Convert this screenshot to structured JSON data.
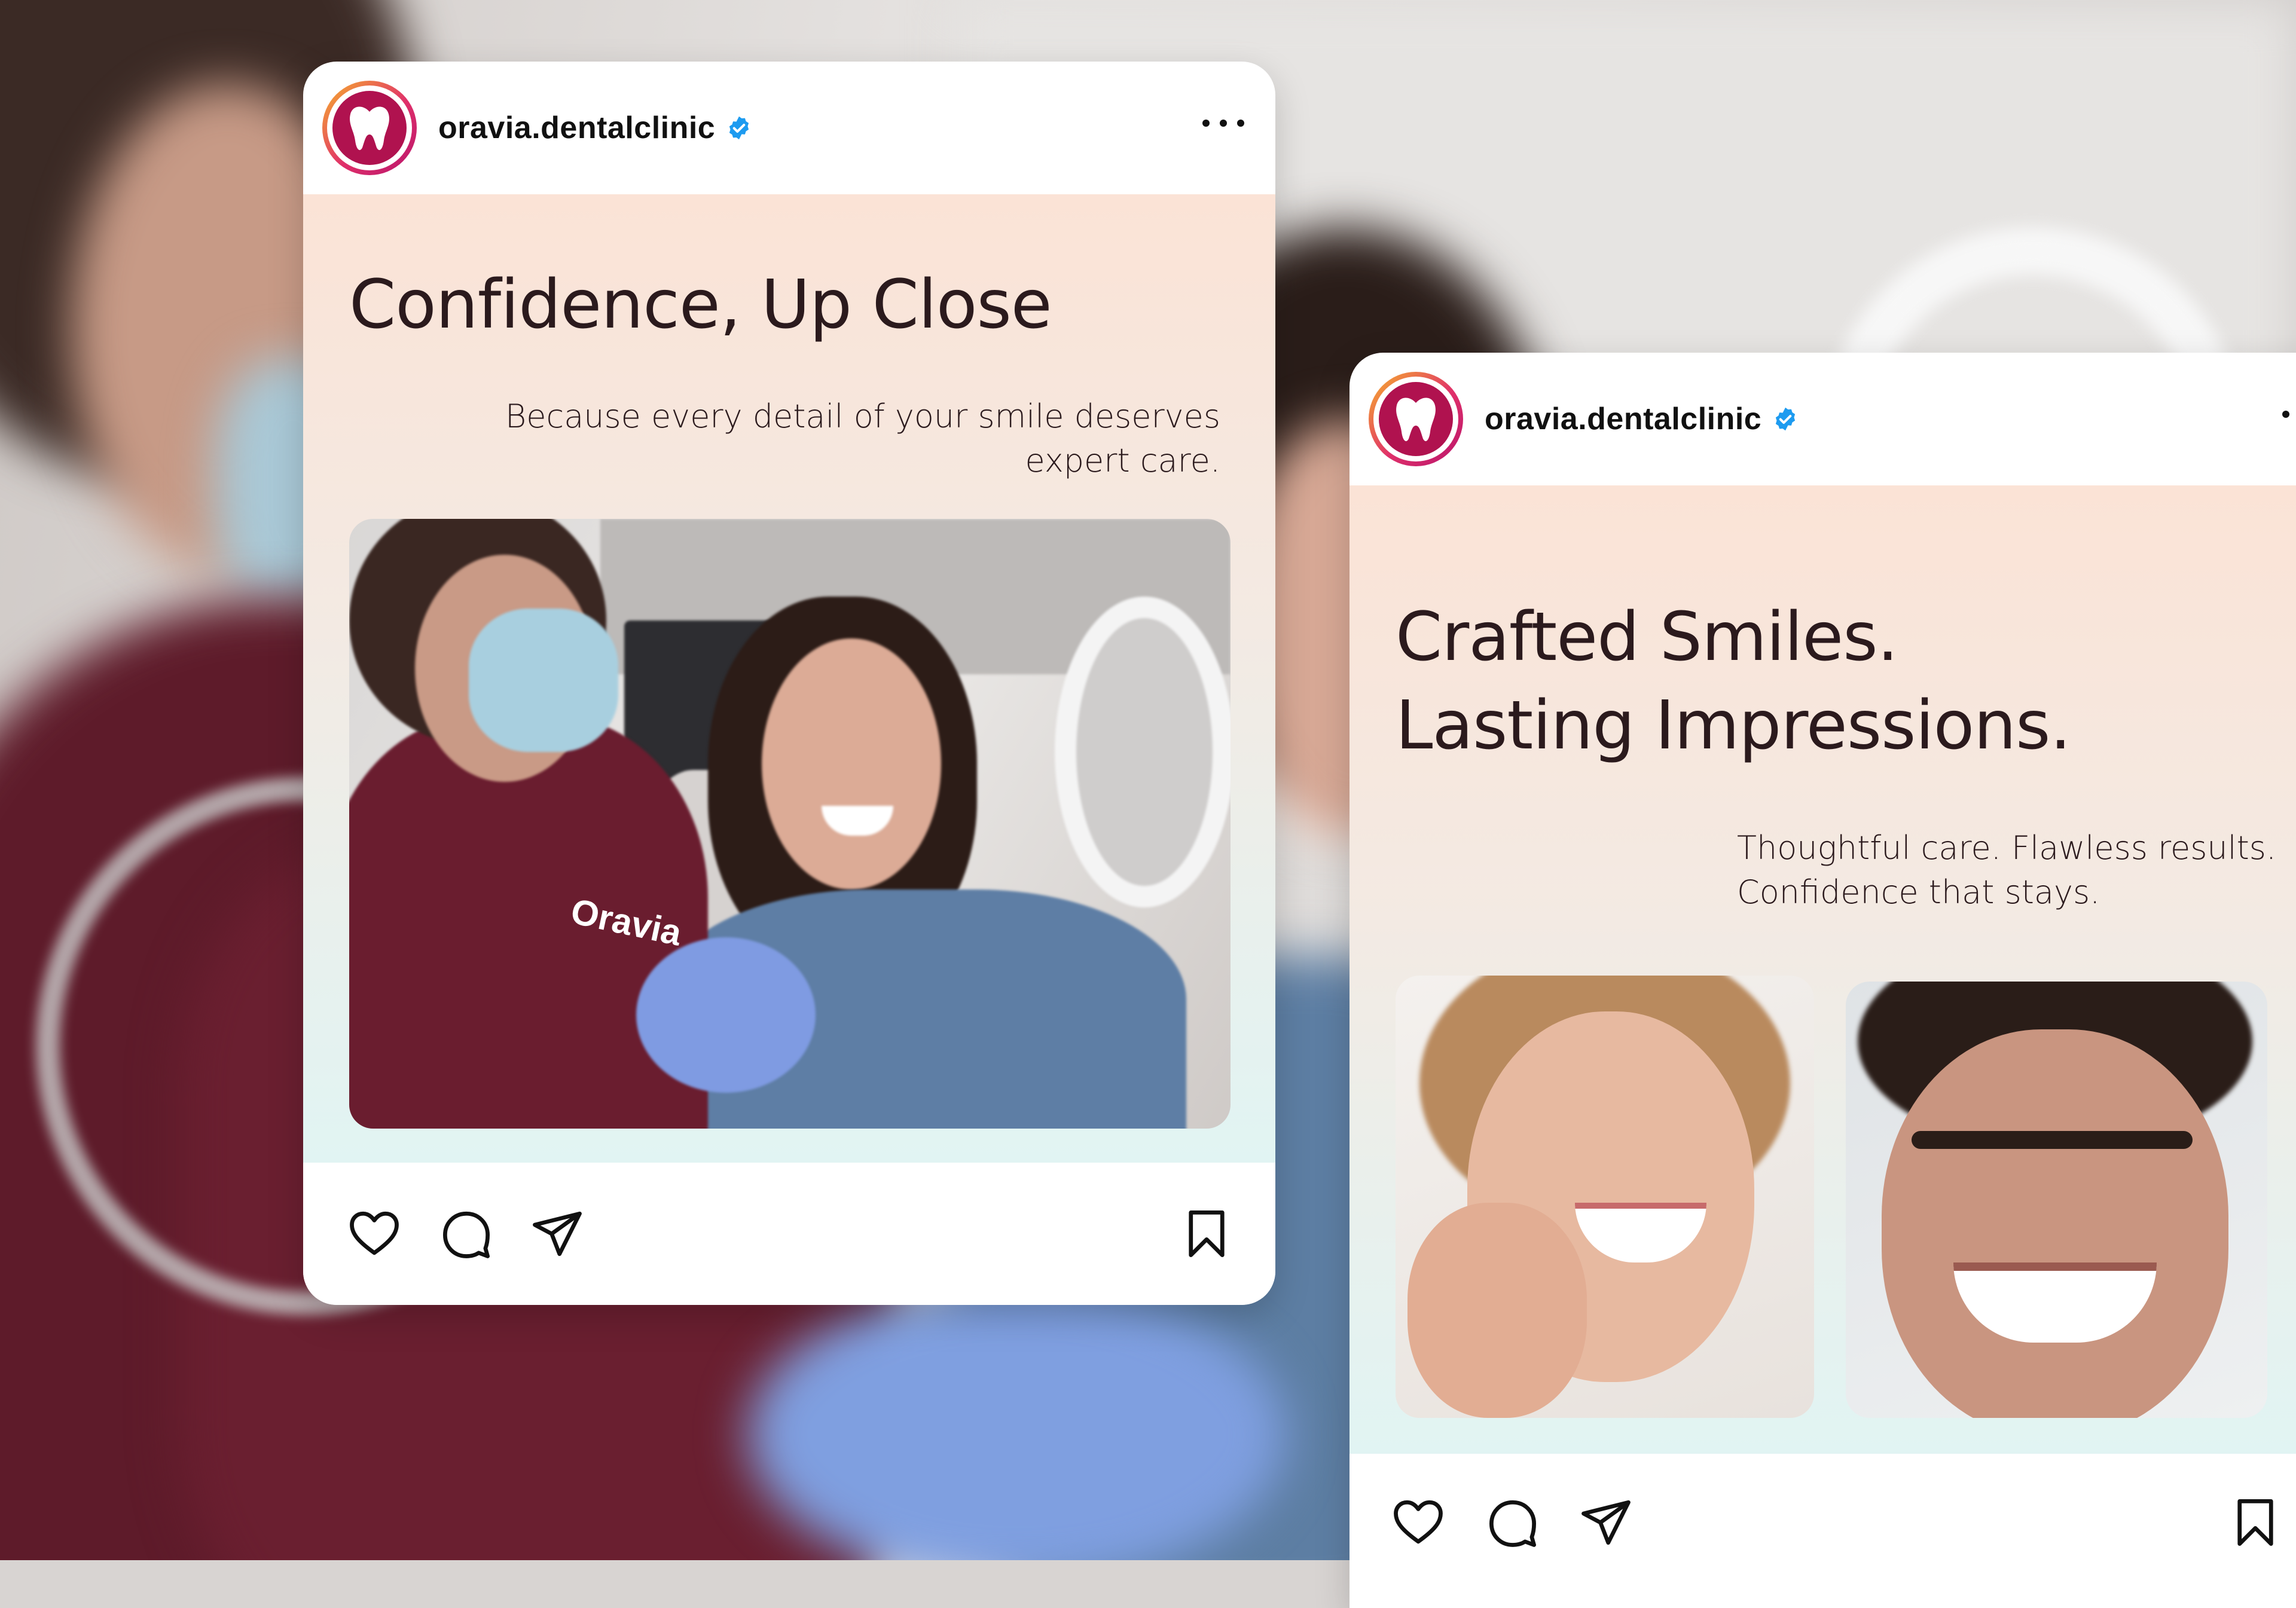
{
  "posts": [
    {
      "account": {
        "username": "oravia.dentalclinic",
        "verified": true,
        "avatar_icon": "tooth-icon",
        "brand_color": "#b0124f"
      },
      "headline_lines": [
        "Confidence, Up Close"
      ],
      "subline": "Because every detail of your smile deserves expert care.",
      "image": {
        "description_icon": "photo-dentist-patient",
        "logo_text": "Oravia"
      },
      "actions": {
        "like_icon": "heart-icon",
        "comment_icon": "comment-icon",
        "share_icon": "send-icon",
        "save_icon": "bookmark-icon",
        "more_icon": "more-dots-icon"
      }
    },
    {
      "account": {
        "username": "oravia.dentalclinic",
        "verified": true,
        "avatar_icon": "tooth-icon",
        "brand_color": "#b0124f"
      },
      "headline_lines": [
        "Crafted Smiles.",
        "Lasting Impressions."
      ],
      "subline_lines": [
        "Thoughtful care. Flawless results.",
        "Confidence that stays."
      ],
      "images": [
        "photo-smiling-woman",
        "photo-smiling-man"
      ],
      "actions": {
        "like_icon": "heart-icon",
        "comment_icon": "comment-icon",
        "share_icon": "send-icon",
        "save_icon": "bookmark-icon",
        "more_icon": "more-dots-icon"
      }
    }
  ],
  "colors": {
    "text_dark": "#2b1a1d",
    "verified_blue": "#1d9bf0",
    "gradient_top": "#fbe3d6",
    "gradient_bottom": "#e1f4f3",
    "scrubs": "#6a1d2f"
  }
}
